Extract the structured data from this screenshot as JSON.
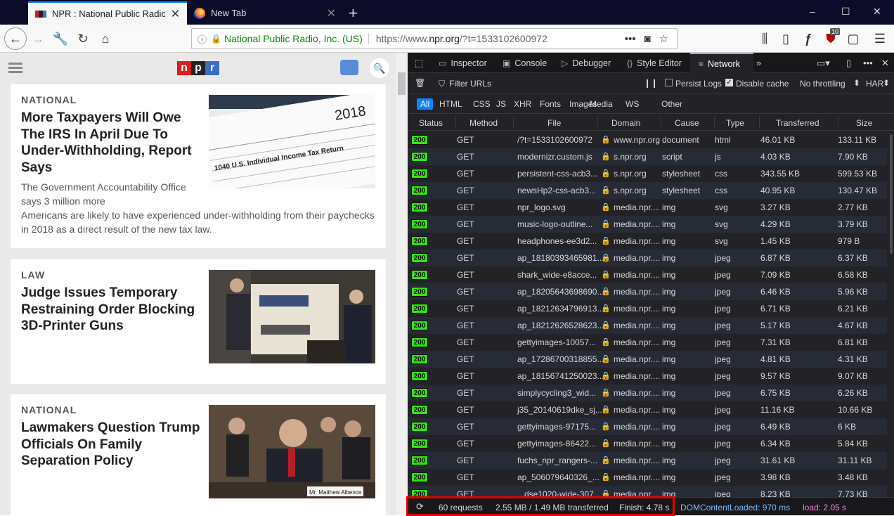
{
  "browser": {
    "tabs": [
      {
        "title": "NPR : National Public Radio : N",
        "active": true
      },
      {
        "title": "New Tab",
        "active": false
      }
    ],
    "window_controls": [
      "–",
      "☐",
      "✕"
    ],
    "urlbar": {
      "identity": "National Public Radio, Inc. (US)",
      "url_prefix": "https://www.",
      "url_domain": "npr.org",
      "url_rest": "/?t=1533102600972"
    },
    "toolbar_badge": "10"
  },
  "page": {
    "cards": [
      {
        "slug": "NATIONAL",
        "headline": "More Taxpayers Will Owe The IRS In April Due To Under-Withholding, Report Says",
        "teaser_short": "The Government Accountability Office says 3 million more",
        "teaser_full": "Americans are likely to have experienced under-withholding from their paychecks in 2018 as a direct result of the new tax law.",
        "image_text": "2018",
        "image_caption": "1040 U.S. Individual Income Tax Return"
      },
      {
        "slug": "LAW",
        "headline": "Judge Issues Temporary Restraining Order Blocking 3D-Printer Guns"
      },
      {
        "slug": "NATIONAL",
        "headline": "Lawmakers Question Trump Officials On Family Separation Policy",
        "nameplate": "Mr. Matthew Albence"
      }
    ]
  },
  "devtools": {
    "tabs": [
      {
        "label": "Inspector",
        "icon": "inspector-icon"
      },
      {
        "label": "Console",
        "icon": "console-icon"
      },
      {
        "label": "Debugger",
        "icon": "debugger-icon"
      },
      {
        "label": "Style Editor",
        "icon": "style-editor-icon"
      },
      {
        "label": "Network",
        "icon": "network-icon",
        "active": true
      }
    ],
    "toolbar": {
      "filter_placeholder": "Filter URLs",
      "persist_logs": "Persist Logs",
      "disable_cache": "Disable cache",
      "throttling": "No throttling",
      "har": "HAR"
    },
    "filter_types": [
      "All",
      "HTML",
      "CSS",
      "JS",
      "XHR",
      "Fonts",
      "Images",
      "Media",
      "WS",
      "Other"
    ],
    "columns": [
      "Status",
      "Method",
      "File",
      "Domain",
      "Cause",
      "Type",
      "Transferred",
      "Size"
    ],
    "requests": [
      {
        "status": "200",
        "method": "GET",
        "file": "/?t=1533102600972",
        "domain": "www.npr.org",
        "cause": "document",
        "type": "html",
        "transferred": "46.01 KB",
        "size": "133.11 KB"
      },
      {
        "status": "200",
        "method": "GET",
        "file": "modernizr.custom.js",
        "domain": "s.npr.org",
        "cause": "script",
        "type": "js",
        "transferred": "4.03 KB",
        "size": "7.90 KB"
      },
      {
        "status": "200",
        "method": "GET",
        "file": "persistent-css-acb3...",
        "domain": "s.npr.org",
        "cause": "stylesheet",
        "type": "css",
        "transferred": "343.55 KB",
        "size": "599.53 KB"
      },
      {
        "status": "200",
        "method": "GET",
        "file": "newsHp2-css-acb3...",
        "domain": "s.npr.org",
        "cause": "stylesheet",
        "type": "css",
        "transferred": "40.95 KB",
        "size": "130.47 KB"
      },
      {
        "status": "200",
        "method": "GET",
        "file": "npr_logo.svg",
        "domain": "media.npr....",
        "cause": "img",
        "type": "svg",
        "transferred": "3.27 KB",
        "size": "2.77 KB"
      },
      {
        "status": "200",
        "method": "GET",
        "file": "music-logo-outline...",
        "domain": "media.npr....",
        "cause": "img",
        "type": "svg",
        "transferred": "4.29 KB",
        "size": "3.79 KB"
      },
      {
        "status": "200",
        "method": "GET",
        "file": "headphones-ee3d2...",
        "domain": "media.npr....",
        "cause": "img",
        "type": "svg",
        "transferred": "1.45 KB",
        "size": "979 B"
      },
      {
        "status": "200",
        "method": "GET",
        "file": "ap_18180393465981...",
        "domain": "media.npr....",
        "cause": "img",
        "type": "jpeg",
        "transferred": "6.87 KB",
        "size": "6.37 KB"
      },
      {
        "status": "200",
        "method": "GET",
        "file": "shark_wide-e8acce...",
        "domain": "media.npr....",
        "cause": "img",
        "type": "jpeg",
        "transferred": "7.09 KB",
        "size": "6.58 KB"
      },
      {
        "status": "200",
        "method": "GET",
        "file": "ap_18205643698690...",
        "domain": "media.npr....",
        "cause": "img",
        "type": "jpeg",
        "transferred": "6.46 KB",
        "size": "5.96 KB"
      },
      {
        "status": "200",
        "method": "GET",
        "file": "ap_18212634796913...",
        "domain": "media.npr....",
        "cause": "img",
        "type": "jpeg",
        "transferred": "6.71 KB",
        "size": "6.21 KB"
      },
      {
        "status": "200",
        "method": "GET",
        "file": "ap_18212626528623...",
        "domain": "media.npr....",
        "cause": "img",
        "type": "jpeg",
        "transferred": "5.17 KB",
        "size": "4.67 KB"
      },
      {
        "status": "200",
        "method": "GET",
        "file": "gettyimages-10057...",
        "domain": "media.npr....",
        "cause": "img",
        "type": "jpeg",
        "transferred": "7.31 KB",
        "size": "6.81 KB"
      },
      {
        "status": "200",
        "method": "GET",
        "file": "ap_17286700318855...",
        "domain": "media.npr....",
        "cause": "img",
        "type": "jpeg",
        "transferred": "4.81 KB",
        "size": "4.31 KB"
      },
      {
        "status": "200",
        "method": "GET",
        "file": "ap_18156741250023...",
        "domain": "media.npr....",
        "cause": "img",
        "type": "jpeg",
        "transferred": "9.57 KB",
        "size": "9.07 KB"
      },
      {
        "status": "200",
        "method": "GET",
        "file": "simplycycling3_wid...",
        "domain": "media.npr....",
        "cause": "img",
        "type": "jpeg",
        "transferred": "6.75 KB",
        "size": "6.26 KB"
      },
      {
        "status": "200",
        "method": "GET",
        "file": "j35_20140619dke_sj...",
        "domain": "media.npr....",
        "cause": "img",
        "type": "jpeg",
        "transferred": "11.16 KB",
        "size": "10.66 KB"
      },
      {
        "status": "200",
        "method": "GET",
        "file": "gettyimages-97175...",
        "domain": "media.npr....",
        "cause": "img",
        "type": "jpeg",
        "transferred": "6.49 KB",
        "size": "6 KB"
      },
      {
        "status": "200",
        "method": "GET",
        "file": "gettyimages-86422...",
        "domain": "media.npr....",
        "cause": "img",
        "type": "jpeg",
        "transferred": "6.34 KB",
        "size": "5.84 KB"
      },
      {
        "status": "200",
        "method": "GET",
        "file": "fuchs_npr_rangers-...",
        "domain": "media.npr....",
        "cause": "img",
        "type": "jpeg",
        "transferred": "31.61 KB",
        "size": "31.11 KB"
      },
      {
        "status": "200",
        "method": "GET",
        "file": "ap_506079640326_...",
        "domain": "media.npr....",
        "cause": "img",
        "type": "jpeg",
        "transferred": "3.98 KB",
        "size": "3.48 KB"
      },
      {
        "status": "200",
        "method": "GET",
        "file": "...dse1020-wide-307...",
        "domain": "media.npr....",
        "cause": "img",
        "type": "jpeg",
        "transferred": "8.23 KB",
        "size": "7.73 KB"
      }
    ],
    "summary": {
      "requests": "60 requests",
      "transferred": "2.55 MB / 1.49 MB transferred",
      "finish": "Finish: 4.78 s",
      "dom_content_loaded": "DOMContentLoaded: 970 ms",
      "load": "load: 2.05 s"
    }
  }
}
